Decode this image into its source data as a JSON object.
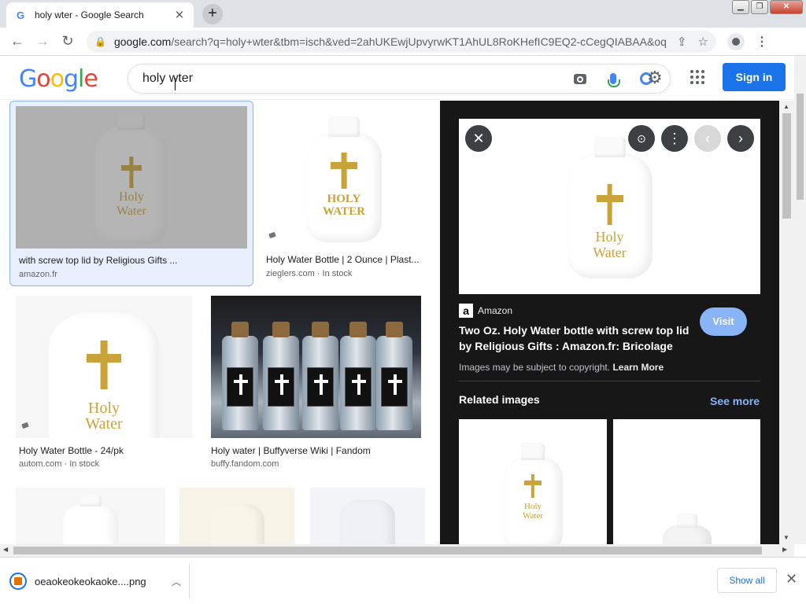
{
  "browser": {
    "tab_title": "holy wter - Google Search",
    "new_tab_symbol": "+",
    "address_host": "google.com",
    "address_path": "/search?q=holy+wter&tbm=isch&ved=2ahUKEwjUpvyrwKT1AhUL8RoKHefIC9EQ2-cCegQIABAA&oq=hol..."
  },
  "google": {
    "logo_letters": [
      "G",
      "o",
      "o",
      "g",
      "l",
      "e"
    ],
    "search_query": "holy wter",
    "sign_in_label": "Sign in"
  },
  "results": [
    {
      "caption": "with screw top lid by Religious Gifts ...",
      "source": "amazon.fr",
      "stock": "",
      "bottle_text_1": "Holy",
      "bottle_text_2": "Water"
    },
    {
      "caption": "Holy Water Bottle | 2 Ounce | Plast...",
      "source": "zieglers.com",
      "stock": "In stock",
      "bottle_text_1": "HOLY",
      "bottle_text_2": "WATER"
    },
    {
      "caption": "Holy Water Bottle - 24/pk",
      "source": "autom.com",
      "stock": "In stock",
      "bottle_text_1": "Holy",
      "bottle_text_2": "Water"
    },
    {
      "caption": "Holy water | Buffyverse Wiki | Fandom",
      "source": "buffy.fandom.com",
      "stock": ""
    }
  ],
  "preview": {
    "source_logo": "a",
    "source_name": "Amazon",
    "title": "Two Oz. Holy Water bottle with screw top lid by Religious Gifts : Amazon.fr: Bricolage",
    "visit_label": "Visit",
    "copyright_text": "Images may be subject to copyright.",
    "learn_more_label": "Learn More",
    "related_title": "Related images",
    "see_more_label": "See more",
    "bottle_text_1": "Holy",
    "bottle_text_2": "Water",
    "related_bottle_text_1": "Holy",
    "related_bottle_text_2": "Water"
  },
  "downloads": {
    "file_name": "oeaokeokeokaoke....png",
    "show_all_label": "Show all"
  },
  "colors": {
    "accent": "#1a73e8",
    "preview_bg": "#171717",
    "cross_gold": "#c9a23a"
  }
}
